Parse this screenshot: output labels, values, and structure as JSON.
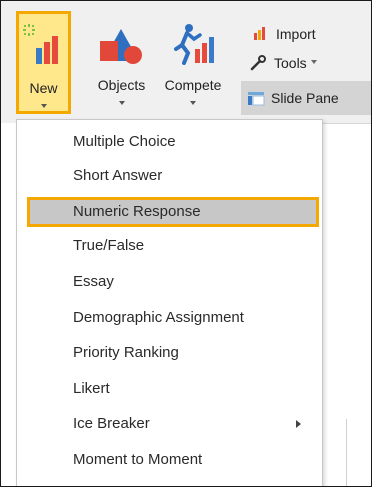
{
  "ribbon": {
    "big_buttons": [
      {
        "label": "New",
        "icon": "new-question-chart-icon"
      },
      {
        "label": "Objects",
        "icon": "shapes-icon"
      },
      {
        "label": "Compete",
        "icon": "runner-chart-icon"
      }
    ],
    "small_buttons": {
      "import_label": "Import",
      "tools_label": "Tools",
      "slide_pane_label": "Slide Pane"
    }
  },
  "menu": {
    "items": [
      {
        "label": "Multiple Choice"
      },
      {
        "label": "Short Answer"
      },
      {
        "label": "Numeric Response",
        "highlighted": true
      },
      {
        "label": "True/False"
      },
      {
        "label": "Essay"
      },
      {
        "label": "Demographic Assignment"
      },
      {
        "label": "Priority Ranking"
      },
      {
        "label": "Likert"
      },
      {
        "label": "Ice Breaker",
        "has_submenu": true
      },
      {
        "label": "Moment to Moment"
      }
    ]
  },
  "colors": {
    "highlight_border": "#f5a800",
    "new_button_fill": "#ffe78c",
    "ribbon_bg": "#f0f0f0",
    "menu_highlight_bg": "#c7c7c7"
  }
}
